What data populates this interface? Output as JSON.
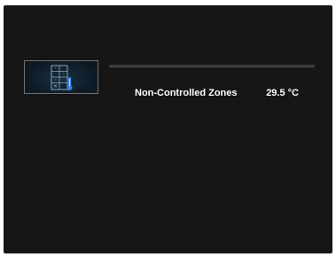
{
  "zone": {
    "name": "Non-Controlled Zones",
    "temperature": "29.5 °C",
    "icon": "building-thermometer-icon"
  },
  "colors": {
    "background": "#161616",
    "tile_border": "#6f7173",
    "tile_fill": "#0f1d29",
    "icon_stroke": "#8ea4b3",
    "thermometer": "#3a84e6",
    "text": "#ffffff",
    "bar": "#3b3c3e"
  }
}
